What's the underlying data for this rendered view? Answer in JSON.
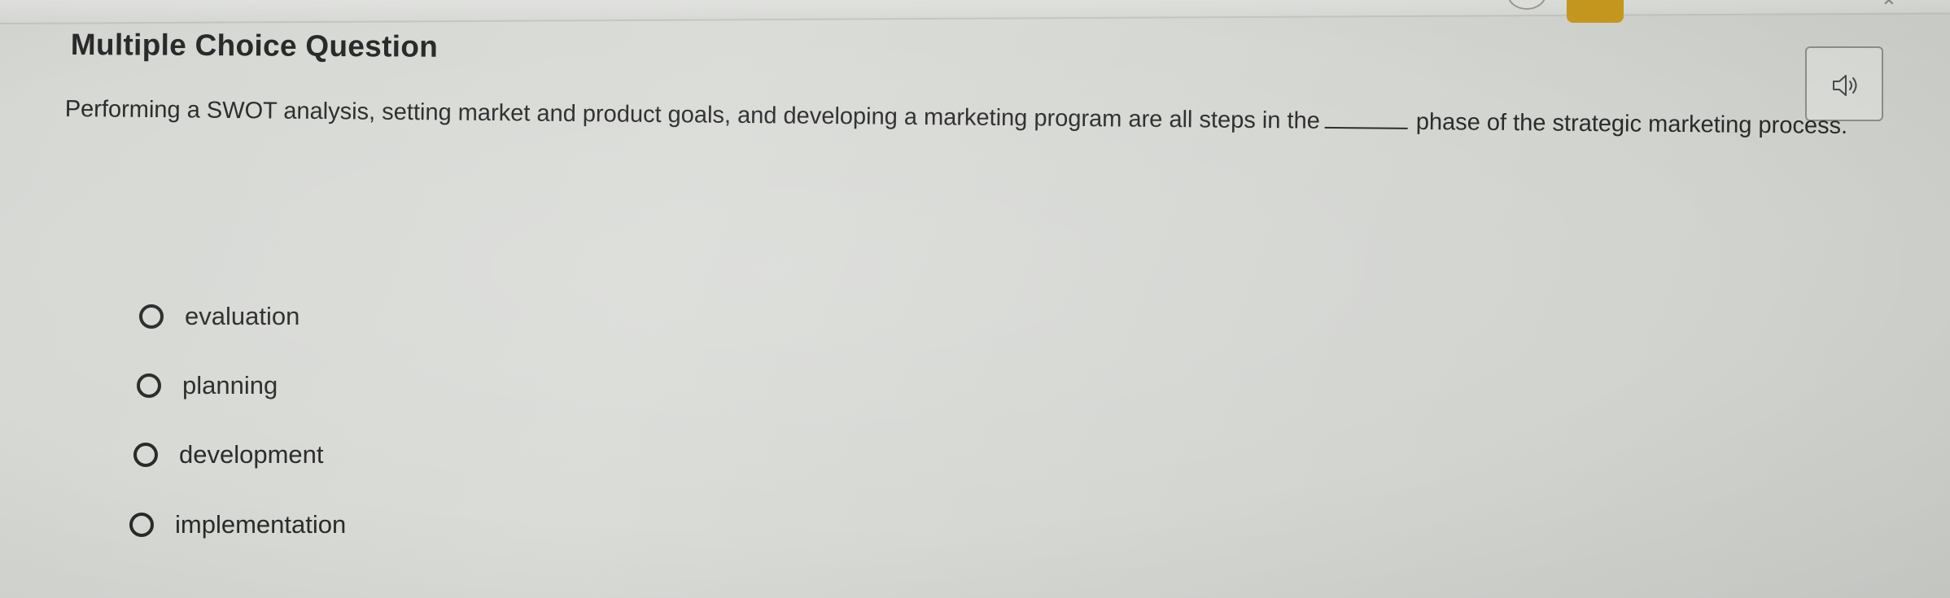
{
  "question": {
    "type_label": "Multiple Choice Question",
    "stem_before": "Performing a SWOT analysis, setting market and product goals, and developing a marketing program are all steps in the",
    "stem_after": "phase of the strategic marketing process.",
    "options": [
      {
        "label": "evaluation",
        "selected": false
      },
      {
        "label": "planning",
        "selected": false
      },
      {
        "label": "development",
        "selected": false
      },
      {
        "label": "implementation",
        "selected": false
      }
    ]
  },
  "audio_button": {
    "icon": "speaker-icon"
  },
  "colors": {
    "background": "#d6d8d4",
    "text": "#2b2b2b",
    "badge": "#c99a1e"
  }
}
